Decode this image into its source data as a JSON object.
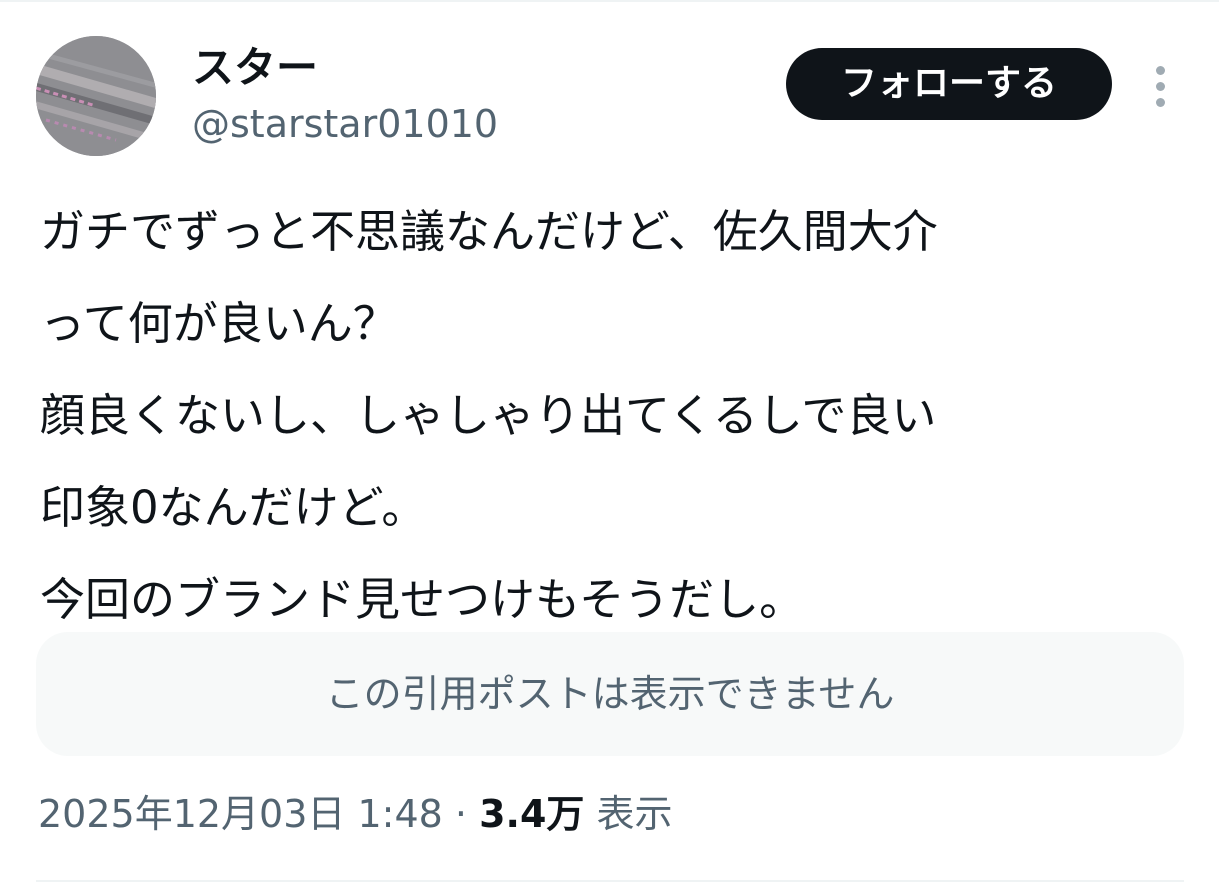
{
  "author": {
    "display_name": "スター",
    "handle": "@starstar01010",
    "avatar_icon": "avatar-photo"
  },
  "actions": {
    "follow_label": "フォローする",
    "more_icon": "more-vertical-icon"
  },
  "post": {
    "lines": [
      "ガチでずっと不思議なんだけど、佐久間大介",
      "って何が良いん？",
      "顔良くないし、しゃしゃり出てくるしで良い",
      "印象0なんだけど。",
      "今回のブランド見せつけもそうだし。"
    ]
  },
  "quote": {
    "unavailable_text": "この引用ポストは表示できません"
  },
  "meta": {
    "timestamp": "2025年12月03日 1:48",
    "separator": "·",
    "views_count": "3.4万",
    "views_label": "表示"
  },
  "colors": {
    "text_primary": "#0f1419",
    "text_secondary": "#536471",
    "follow_bg": "#0f1419",
    "quote_bg": "#f7f9f9",
    "divider": "#eff3f4"
  }
}
